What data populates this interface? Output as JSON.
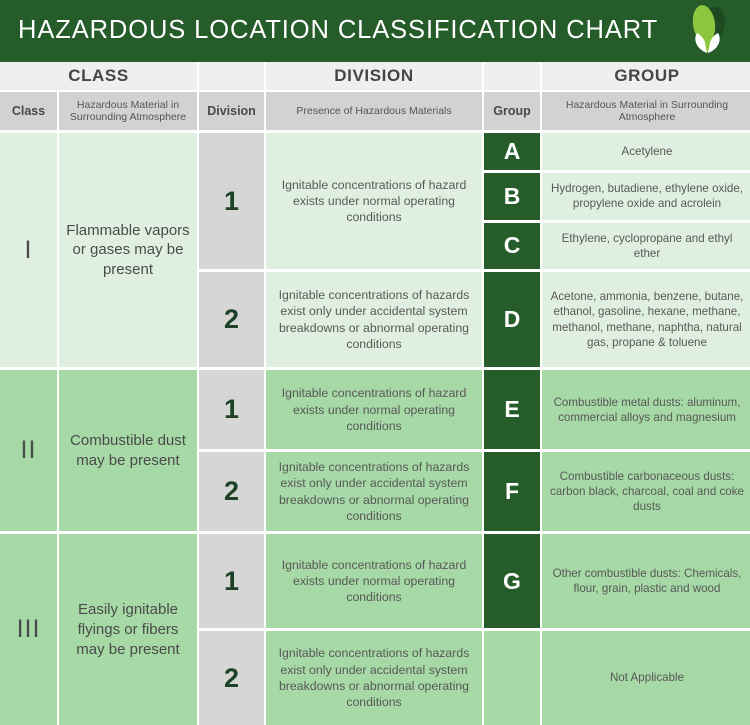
{
  "header": {
    "title": "HAZARDOUS LOCATION CLASSIFICATION CHART",
    "logo_icon": "leaf-logo-icon",
    "bg_color": "#255c2a",
    "title_color": "#ffffff"
  },
  "band": {
    "class_label": "CLASS",
    "division_label": "DIVISION",
    "group_label": "GROUP"
  },
  "subheader": {
    "class": "Class",
    "class_desc": "Hazardous Material in Surrounding Atmosphere",
    "division": "Division",
    "division_desc": "Presence of Hazardous Materials",
    "group": "Group",
    "group_desc": "Hazardous Material in Surrounding Atmosphere"
  },
  "colors": {
    "dark_green": "#255c2a",
    "light_green": "#dff0e1",
    "mid_green": "#a6d9a6",
    "band_gray": "#efefef",
    "subhead_gray": "#d2d2d2",
    "division_gray": "#d6d6d6",
    "text_gray": "#585858"
  },
  "classes": [
    {
      "number": "I",
      "description": "Flammable vapors or gases may be present",
      "tone": "light",
      "divisions": [
        {
          "number": "1",
          "description": "Ignitable concentrations of hazard exists under normal operating conditions",
          "groups": [
            {
              "letter": "A",
              "materials": "Acetylene"
            },
            {
              "letter": "B",
              "materials": "Hydrogen, butadiene, ethylene oxide, propylene oxide and acrolein"
            },
            {
              "letter": "C",
              "materials": "Ethylene, cyclopropane and ethyl ether"
            }
          ]
        },
        {
          "number": "2",
          "description": "Ignitable concentrations of hazards exist only under accidental system breakdowns or abnormal operating conditions",
          "groups": [
            {
              "letter": "D",
              "materials": "Acetone, ammonia, benzene, butane, ethanol, gasoline, hexane, methane, methanol, methane, naphtha, natural gas, propane & toluene"
            }
          ]
        }
      ]
    },
    {
      "number": "II",
      "description": "Combustible dust may be present",
      "tone": "mid",
      "divisions": [
        {
          "number": "1",
          "description": "Ignitable concentrations of hazard exists under normal operating conditions",
          "groups": [
            {
              "letter": "E",
              "materials": "Combustible metal dusts: aluminum, commercial alloys and magnesium"
            }
          ]
        },
        {
          "number": "2",
          "description": "Ignitable concentrations of hazards exist only under accidental system breakdowns or abnormal operating conditions",
          "groups": [
            {
              "letter": "F",
              "materials": "Combustible carbonaceous dusts: carbon black, charcoal, coal and coke dusts"
            }
          ]
        }
      ]
    },
    {
      "number": "III",
      "description": "Easily ignitable flyings or fibers may be present",
      "tone": "mid",
      "divisions": [
        {
          "number": "1",
          "description": "Ignitable concentrations of hazard exists under normal operating conditions",
          "groups": [
            {
              "letter": "G",
              "materials": "Other combustible dusts: Chemicals, flour, grain, plastic and wood"
            }
          ]
        },
        {
          "number": "2",
          "description": "Ignitable concentrations of hazards exist only under accidental system breakdowns or abnormal operating conditions",
          "groups": [
            {
              "letter": "",
              "materials": "Not Applicable"
            }
          ]
        }
      ]
    }
  ]
}
